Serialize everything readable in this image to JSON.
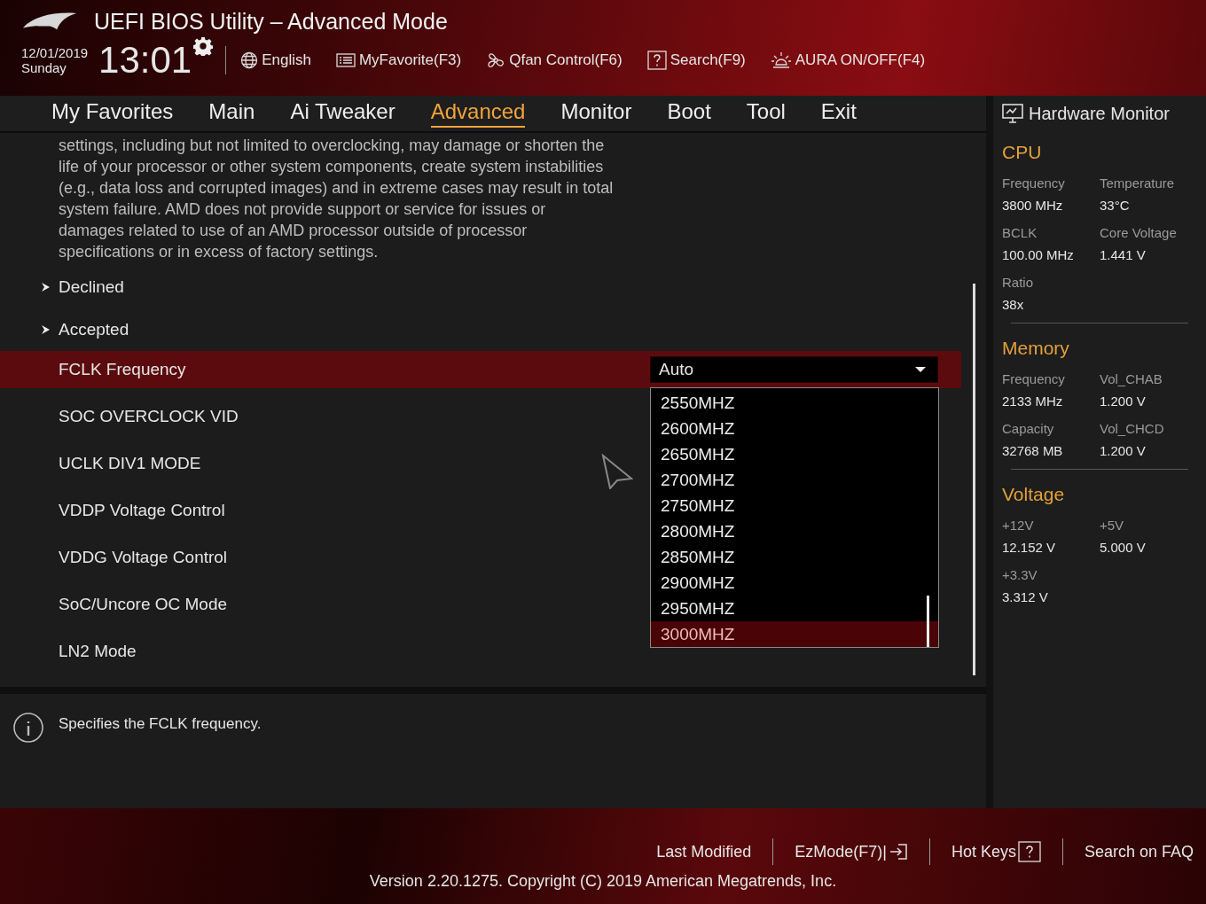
{
  "header": {
    "title": "UEFI BIOS Utility – Advanced Mode",
    "date": "12/01/2019",
    "day": "Sunday",
    "time": "13:01",
    "tools": [
      {
        "label": "English"
      },
      {
        "label": "MyFavorite(F3)"
      },
      {
        "label": "Qfan Control(F6)"
      },
      {
        "label": "Search(F9)"
      },
      {
        "label": "AURA ON/OFF(F4)"
      }
    ]
  },
  "tabs": [
    {
      "label": "My Favorites",
      "selected": false
    },
    {
      "label": "Main",
      "selected": false
    },
    {
      "label": "Ai Tweaker",
      "selected": false
    },
    {
      "label": "Advanced",
      "selected": true
    },
    {
      "label": "Monitor",
      "selected": false
    },
    {
      "label": "Boot",
      "selected": false
    },
    {
      "label": "Tool",
      "selected": false
    },
    {
      "label": "Exit",
      "selected": false
    }
  ],
  "description_lines": [
    "settings, including but not limited to overclocking, may damage or shorten the",
    "life of your processor or other system components, create system instabilities",
    "(e.g., data loss and corrupted images) and in extreme cases may result in total",
    "system failure. AMD does not provide support or service for issues or",
    "damages related to use of an AMD processor outside of processor",
    "specifications or in excess of factory settings."
  ],
  "submenus": [
    {
      "label": "Declined",
      "expanded": false
    },
    {
      "label": "Accepted",
      "expanded": false
    }
  ],
  "settings": [
    {
      "label": "FCLK Frequency",
      "selected": true,
      "value": "Auto",
      "open": true
    },
    {
      "label": "SOC OVERCLOCK VID",
      "selected": false
    },
    {
      "label": "UCLK DIV1 MODE",
      "selected": false
    },
    {
      "label": "VDDP Voltage Control",
      "selected": false
    },
    {
      "label": "VDDG Voltage Control",
      "selected": false
    },
    {
      "label": "SoC/Uncore OC Mode",
      "selected": false
    },
    {
      "label": "LN2 Mode",
      "selected": false
    }
  ],
  "dropdown_options": [
    {
      "label": "2550MHZ",
      "selected": false
    },
    {
      "label": "2600MHZ",
      "selected": false
    },
    {
      "label": "2650MHZ",
      "selected": false
    },
    {
      "label": "2700MHZ",
      "selected": false
    },
    {
      "label": "2750MHZ",
      "selected": false
    },
    {
      "label": "2800MHZ",
      "selected": false
    },
    {
      "label": "2850MHZ",
      "selected": false
    },
    {
      "label": "2900MHZ",
      "selected": false
    },
    {
      "label": "2950MHZ",
      "selected": false
    },
    {
      "label": "3000MHZ",
      "selected": true
    }
  ],
  "help_text": "Specifies the FCLK frequency.",
  "hardware_monitor": {
    "title": "Hardware Monitor",
    "sections": [
      {
        "title": "CPU",
        "items": [
          {
            "label": "Frequency",
            "value": "3800 MHz"
          },
          {
            "label": "Temperature",
            "value": "33°C"
          },
          {
            "label": "BCLK",
            "value": "100.00 MHz"
          },
          {
            "label": "Core Voltage",
            "value": "1.441 V"
          },
          {
            "label": "Ratio",
            "value": "38x"
          }
        ]
      },
      {
        "title": "Memory",
        "items": [
          {
            "label": "Frequency",
            "value": "2133 MHz"
          },
          {
            "label": "Vol_CHAB",
            "value": "1.200 V"
          },
          {
            "label": "Capacity",
            "value": "32768 MB"
          },
          {
            "label": "Vol_CHCD",
            "value": "1.200 V"
          }
        ]
      },
      {
        "title": "Voltage",
        "items": [
          {
            "label": "+12V",
            "value": "12.152 V"
          },
          {
            "label": "+5V",
            "value": "5.000 V"
          },
          {
            "label": "+3.3V",
            "value": "3.312 V"
          }
        ]
      }
    ]
  },
  "footer": {
    "buttons": [
      {
        "label": "Last Modified"
      },
      {
        "label": "EzMode(F7)|"
      },
      {
        "label": "Hot Keys"
      },
      {
        "label": "Search on FAQ"
      }
    ],
    "version": "Version 2.20.1275. Copyright (C) 2019 American Megatrends, Inc."
  }
}
